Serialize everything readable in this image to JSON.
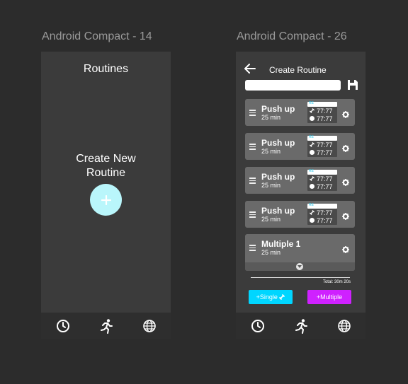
{
  "frame1": {
    "label": "Android Compact - 14",
    "title": "Routines",
    "create_line1": "Create New",
    "create_line2": "Routine",
    "fab_icon": "plus-icon"
  },
  "frame2": {
    "label": "Android Compact - 26",
    "title": "Create Routine",
    "name_input_value": "",
    "exercises": [
      {
        "name": "Push up",
        "duration": "25 min",
        "stat_top": "RE",
        "reps": "77:77",
        "rest": "77:77"
      },
      {
        "name": "Push up",
        "duration": "25 min",
        "stat_top": "RE",
        "reps": "77:77",
        "rest": "77:77"
      },
      {
        "name": "Push up",
        "duration": "25 min",
        "stat_top": "RE",
        "reps": "77:77",
        "rest": "77:77"
      },
      {
        "name": "Push up",
        "duration": "25 min",
        "stat_top": "RE",
        "reps": "77:77",
        "rest": "77:77"
      }
    ],
    "multiple": {
      "name": "Multiple 1",
      "duration": "25 min"
    },
    "total": "Total: 30m 20s",
    "single_button": "+Single",
    "multiple_button": "+Multiple"
  },
  "nav": {
    "icons": [
      "clock-icon",
      "running-icon",
      "globe-icon"
    ]
  },
  "colors": {
    "background": "#2c2c2c",
    "frame": "#3b3b3b",
    "navbar": "#2e2e2e",
    "card": "#6a6a6a",
    "fab": "#b9f6fb",
    "single_button": "#00d6ff",
    "multiple_button": "#cf21ff"
  }
}
